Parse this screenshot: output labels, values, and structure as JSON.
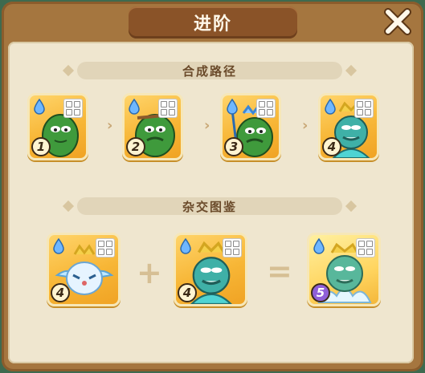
{
  "window": {
    "title": "进阶"
  },
  "sections": {
    "synthesis_path": {
      "title": "合成路径",
      "steps": [
        {
          "level": "1"
        },
        {
          "level": "2"
        },
        {
          "level": "3"
        },
        {
          "level": "4"
        }
      ]
    },
    "crossbreed": {
      "title": "杂交图鉴",
      "plus": "+",
      "equals": "=",
      "inputs": [
        {
          "level": "4"
        },
        {
          "level": "4"
        }
      ],
      "result": {
        "level": "5"
      }
    }
  },
  "colors": {
    "frame": "#a5763f",
    "panel": "#efe6cf",
    "card": "#f7b636",
    "result_badge": "#8f5fd7"
  },
  "icons": [
    "close-icon",
    "water-drop-icon",
    "grid-icon",
    "chevron-right-icon",
    "plus-icon",
    "equals-icon"
  ]
}
